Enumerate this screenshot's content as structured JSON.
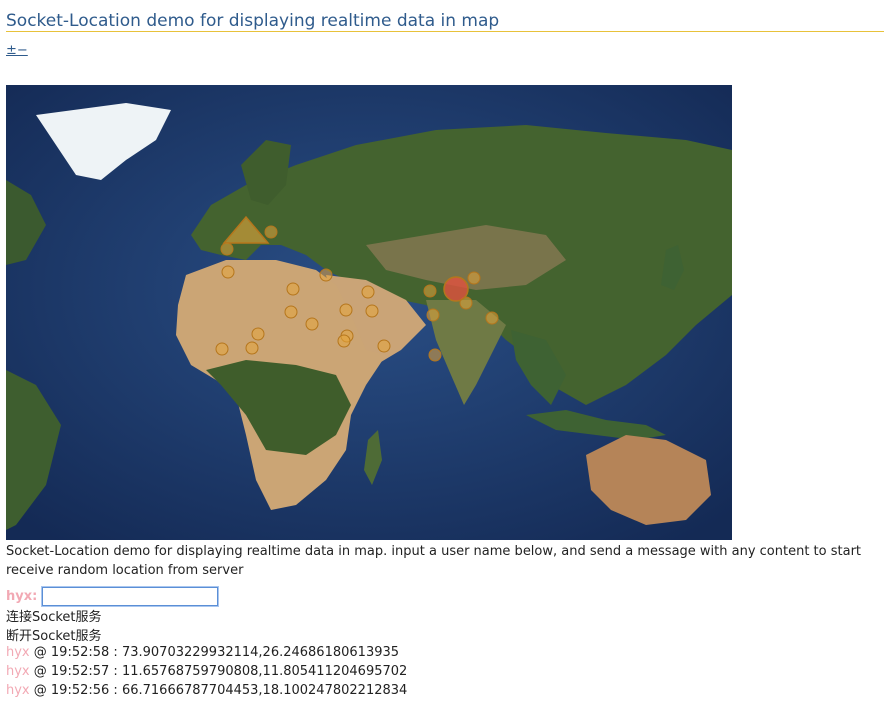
{
  "page": {
    "title": "Socket-Location demo for displaying realtime data in map",
    "zoom_control": "±−"
  },
  "map": {
    "colors": {
      "ocean": "#1f3f73",
      "ocean_deep": "#172f5c",
      "land_green": "#3a5a2c",
      "land_desert": "#c9a274",
      "ice": "#eef3f6",
      "marker_fill": "#e5a63c",
      "marker_stroke": "#b5761c",
      "marker_highlight": "#e2513e"
    },
    "markers": [
      {
        "name": "marker-triangle",
        "shape": "triangle"
      },
      {
        "name": "marker-dot",
        "shape": "circle"
      },
      {
        "name": "marker-highlight",
        "shape": "circle-large"
      }
    ]
  },
  "description": "Socket-Location demo for displaying realtime data in map. input a user name below, and send a message with any content to start receive random location from server",
  "input": {
    "user_label": "hyx:",
    "value": "",
    "placeholder": ""
  },
  "actions": {
    "connect": "连接Socket服务",
    "disconnect": "断开Socket服务"
  },
  "log": [
    {
      "user": "hyx",
      "time": "19:52:58",
      "coords": "73.90703229932114,26.24686180613935"
    },
    {
      "user": "hyx",
      "time": "19:52:57",
      "coords": "11.65768759790808,11.805411204695702"
    },
    {
      "user": "hyx",
      "time": "19:52:56",
      "coords": "66.71666787704453,18.100247802212834"
    }
  ]
}
